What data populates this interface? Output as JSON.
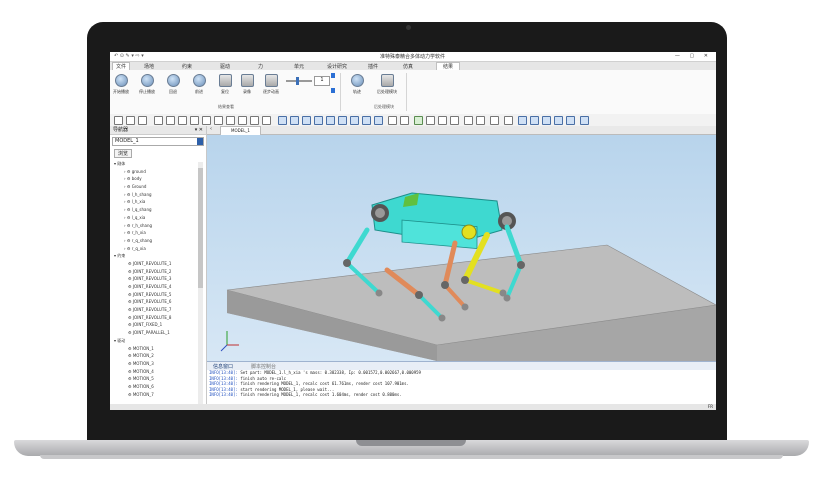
{
  "app": {
    "title": "准特殊泰精合多体动力学软件",
    "quick_access": "↶ ⊙ ✎ ▾ ⇨ ▾",
    "window_controls": "— ▢ ✕"
  },
  "menu": {
    "file": "文件",
    "items": [
      {
        "label": "场地"
      },
      {
        "label": "约束"
      },
      {
        "label": "驱动"
      },
      {
        "label": "力"
      },
      {
        "label": "单元"
      },
      {
        "label": "设计研究"
      },
      {
        "label": "插件"
      },
      {
        "label": "仿真"
      },
      {
        "label": "结果"
      }
    ]
  },
  "ribbon": {
    "buttons": [
      {
        "label": "开始播放"
      },
      {
        "label": "停止播放"
      },
      {
        "label": "回退"
      },
      {
        "label": "前进"
      },
      {
        "label": "复位"
      },
      {
        "label": "录像"
      },
      {
        "label": "逐步动画"
      },
      {
        "label": "轨迹"
      },
      {
        "label": "后处理模块"
      }
    ],
    "groups": [
      {
        "label": "结果查看"
      },
      {
        "label": "后处理模块"
      }
    ],
    "frame_value": "1"
  },
  "navigator": {
    "title": "导航器",
    "pin": "▾ ✕",
    "model": "MODEL_1",
    "tab": "浏览",
    "tree": [
      {
        "label": "▾ 刚体",
        "kind": "group"
      },
      {
        "label": "› ⚙ ground",
        "kind": "item"
      },
      {
        "label": "› ⚙ body",
        "kind": "item"
      },
      {
        "label": "› ⚙ Ground",
        "kind": "item"
      },
      {
        "label": "› ⚙ l_h_shang",
        "kind": "item"
      },
      {
        "label": "› ⚙ l_h_xia",
        "kind": "item"
      },
      {
        "label": "› ⚙ l_q_shang",
        "kind": "item"
      },
      {
        "label": "› ⚙ l_q_xia",
        "kind": "item"
      },
      {
        "label": "› ⚙ r_h_shang",
        "kind": "item"
      },
      {
        "label": "› ⚙ r_h_xia",
        "kind": "item"
      },
      {
        "label": "› ⚙ r_q_shang",
        "kind": "item"
      },
      {
        "label": "› ⚙ r_q_xia",
        "kind": "item"
      },
      {
        "label": "▾ 约束",
        "kind": "group"
      },
      {
        "label": "⚙ JOINT_REVOLUTE_1",
        "kind": "sub"
      },
      {
        "label": "⚙ JOINT_REVOLUTE_2",
        "kind": "sub"
      },
      {
        "label": "⚙ JOINT_REVOLUTE_3",
        "kind": "sub"
      },
      {
        "label": "⚙ JOINT_REVOLUTE_4",
        "kind": "sub"
      },
      {
        "label": "⚙ JOINT_REVOLUTE_5",
        "kind": "sub"
      },
      {
        "label": "⚙ JOINT_REVOLUTE_6",
        "kind": "sub"
      },
      {
        "label": "⚙ JOINT_REVOLUTE_7",
        "kind": "sub"
      },
      {
        "label": "⚙ JOINT_REVOLUTE_8",
        "kind": "sub"
      },
      {
        "label": "⚙ JOINT_FIXED_1",
        "kind": "sub"
      },
      {
        "label": "⚙ JOINT_PARALLEL_1",
        "kind": "sub"
      },
      {
        "label": "▾ 驱动",
        "kind": "group"
      },
      {
        "label": "⚙ MOTION_1",
        "kind": "sub"
      },
      {
        "label": "⚙ MOTION_2",
        "kind": "sub"
      },
      {
        "label": "⚙ MOTION_3",
        "kind": "sub"
      },
      {
        "label": "⚙ MOTION_4",
        "kind": "sub"
      },
      {
        "label": "⚙ MOTION_5",
        "kind": "sub"
      },
      {
        "label": "⚙ MOTION_6",
        "kind": "sub"
      },
      {
        "label": "⚙ MOTION_7",
        "kind": "sub"
      }
    ]
  },
  "document_tab": "MODEL_1",
  "console": {
    "tabs": [
      {
        "label": "信息窗口"
      },
      {
        "label": "脚本控制台"
      }
    ],
    "lines": [
      {
        "tag": "INFO[13:40]:",
        "text": " Set part: MODEL_1.l_h_xia 's mass: 0.382338, Ip: 0.001572,0.002667,0.000959"
      },
      {
        "tag": "INFO[13:40]:",
        "text": " finish auto re-calc"
      },
      {
        "tag": "INFO[13:40]:",
        "text": " finish rendering MODEL_1, recalc cost 61.761ms, render cost 107.901ms."
      },
      {
        "tag": "INFO[13:40]:",
        "text": " start rendering MODEL_1, please wait..."
      },
      {
        "tag": "INFO[13:40]:",
        "text": " finish rendering MODEL_1, recalc cost 1.604ms, render cost 0.800ms."
      }
    ]
  },
  "status": {
    "right": "FR"
  },
  "colors": {
    "body": "#3ed9d0",
    "leg_front": "#e3e020",
    "leg_orange": "#e08a5a",
    "leg_cyan": "#3ed9d0",
    "ground_plate": "#bdbdbd",
    "viewport_top": "#b8d4ec"
  }
}
